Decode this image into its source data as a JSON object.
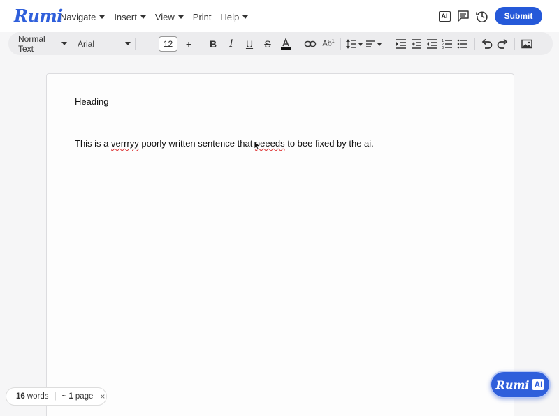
{
  "app": {
    "logo": "Rumi"
  },
  "menu": {
    "items": [
      {
        "label": "Navigate",
        "has_caret": true
      },
      {
        "label": "Insert",
        "has_caret": true
      },
      {
        "label": "View",
        "has_caret": true
      },
      {
        "label": "Print",
        "has_caret": false
      },
      {
        "label": "Help",
        "has_caret": true
      }
    ]
  },
  "top_actions": {
    "ai_label": "AI",
    "submit_label": "Submit"
  },
  "toolbar": {
    "style_select": "Normal Text",
    "font_select": "Arial",
    "font_size": "12",
    "minus": "–",
    "plus": "+",
    "superscript_label": "Ab"
  },
  "document": {
    "heading": "Heading",
    "sentence_parts": {
      "p1": "This is a ",
      "p2": "verrryy",
      "p3": " poorly written sentence that ",
      "p4": "neeeds",
      "p5": " to bee fixed by the ai."
    }
  },
  "status": {
    "word_count": "16",
    "words_label": "words",
    "page_prefix": "~",
    "page_count": "1",
    "page_label": "page",
    "close": "×"
  },
  "rumi_ai_button": {
    "logo": "Rumi",
    "badge": "AI"
  },
  "colors": {
    "accent": "#2f5fdb",
    "submit": "#2559d9",
    "toolbar_bg": "#ececee",
    "spellcheck": "#d33"
  }
}
